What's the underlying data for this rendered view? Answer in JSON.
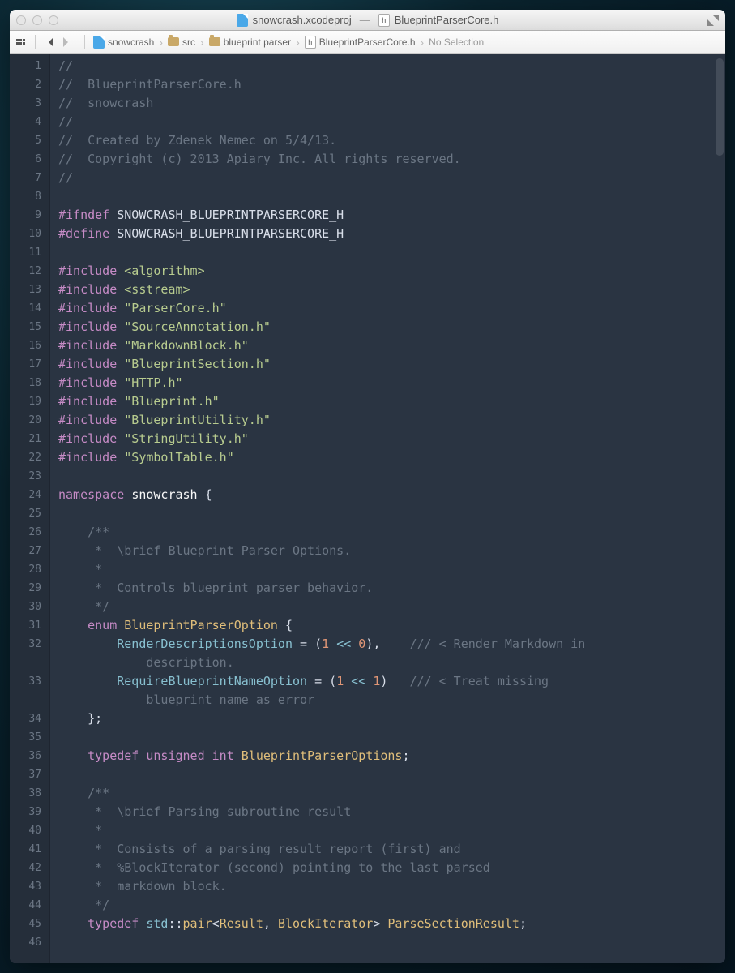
{
  "titlebar": {
    "project_name": "snowcrash.xcodeproj",
    "separator": "—",
    "file_name": "BlueprintParserCore.h",
    "h_label": "h"
  },
  "pathbar": {
    "crumbs": [
      {
        "icon": "project",
        "label": "snowcrash"
      },
      {
        "icon": "folder",
        "label": "src"
      },
      {
        "icon": "folder",
        "label": "blueprint parser"
      },
      {
        "icon": "hfile",
        "label": "BlueprintParserCore.h"
      }
    ],
    "no_selection": "No Selection"
  },
  "line_start": 1,
  "line_end": 46,
  "code_lines": [
    [
      {
        "c": "c-comment",
        "t": "//"
      }
    ],
    [
      {
        "c": "c-comment",
        "t": "//  BlueprintParserCore.h"
      }
    ],
    [
      {
        "c": "c-comment",
        "t": "//  snowcrash"
      }
    ],
    [
      {
        "c": "c-comment",
        "t": "//"
      }
    ],
    [
      {
        "c": "c-comment",
        "t": "//  Created by Zdenek Nemec on 5/4/13."
      }
    ],
    [
      {
        "c": "c-comment",
        "t": "//  Copyright (c) 2013 Apiary Inc. All rights reserved."
      }
    ],
    [
      {
        "c": "c-comment",
        "t": "//"
      }
    ],
    [],
    [
      {
        "c": "c-define",
        "t": "#ifndef "
      },
      {
        "c": "c-macro",
        "t": "SNOWCRASH_BLUEPRINTPARSERCORE_H"
      }
    ],
    [
      {
        "c": "c-define",
        "t": "#define "
      },
      {
        "c": "c-macro",
        "t": "SNOWCRASH_BLUEPRINTPARSERCORE_H"
      }
    ],
    [],
    [
      {
        "c": "c-define",
        "t": "#include "
      },
      {
        "c": "c-string",
        "t": "<algorithm>"
      }
    ],
    [
      {
        "c": "c-define",
        "t": "#include "
      },
      {
        "c": "c-string",
        "t": "<sstream>"
      }
    ],
    [
      {
        "c": "c-define",
        "t": "#include "
      },
      {
        "c": "c-string",
        "t": "\"ParserCore.h\""
      }
    ],
    [
      {
        "c": "c-define",
        "t": "#include "
      },
      {
        "c": "c-string",
        "t": "\"SourceAnnotation.h\""
      }
    ],
    [
      {
        "c": "c-define",
        "t": "#include "
      },
      {
        "c": "c-string",
        "t": "\"MarkdownBlock.h\""
      }
    ],
    [
      {
        "c": "c-define",
        "t": "#include "
      },
      {
        "c": "c-string",
        "t": "\"BlueprintSection.h\""
      }
    ],
    [
      {
        "c": "c-define",
        "t": "#include "
      },
      {
        "c": "c-string",
        "t": "\"HTTP.h\""
      }
    ],
    [
      {
        "c": "c-define",
        "t": "#include "
      },
      {
        "c": "c-string",
        "t": "\"Blueprint.h\""
      }
    ],
    [
      {
        "c": "c-define",
        "t": "#include "
      },
      {
        "c": "c-string",
        "t": "\"BlueprintUtility.h\""
      }
    ],
    [
      {
        "c": "c-define",
        "t": "#include "
      },
      {
        "c": "c-string",
        "t": "\"StringUtility.h\""
      }
    ],
    [
      {
        "c": "c-define",
        "t": "#include "
      },
      {
        "c": "c-string",
        "t": "\"SymbolTable.h\""
      }
    ],
    [],
    [
      {
        "c": "c-keyword",
        "t": "namespace "
      },
      {
        "c": "c-ident",
        "t": "snowcrash "
      },
      {
        "c": "",
        "t": "{"
      }
    ],
    [],
    [
      {
        "c": "c-comment",
        "t": "    /**"
      }
    ],
    [
      {
        "c": "c-comment",
        "t": "     *  \\brief Blueprint Parser Options."
      }
    ],
    [
      {
        "c": "c-comment",
        "t": "     *"
      }
    ],
    [
      {
        "c": "c-comment",
        "t": "     *  Controls blueprint parser behavior."
      }
    ],
    [
      {
        "c": "c-comment",
        "t": "     */"
      }
    ],
    [
      {
        "c": "",
        "t": "    "
      },
      {
        "c": "c-keyword",
        "t": "enum "
      },
      {
        "c": "c-type",
        "t": "BlueprintParserOption "
      },
      {
        "c": "",
        "t": "{"
      }
    ],
    [
      {
        "c": "",
        "t": "        "
      },
      {
        "c": "c-enum",
        "t": "RenderDescriptionsOption"
      },
      {
        "c": "",
        "t": " = ("
      },
      {
        "c": "c-number",
        "t": "1"
      },
      {
        "c": "",
        "t": " "
      },
      {
        "c": "c-op",
        "t": "<<"
      },
      {
        "c": "",
        "t": " "
      },
      {
        "c": "c-number",
        "t": "0"
      },
      {
        "c": "",
        "t": "),    "
      },
      {
        "c": "c-comment",
        "t": "/// < Render Markdown in\n            description."
      }
    ],
    [
      {
        "c": "",
        "t": "        "
      },
      {
        "c": "c-enum",
        "t": "RequireBlueprintNameOption"
      },
      {
        "c": "",
        "t": " = ("
      },
      {
        "c": "c-number",
        "t": "1"
      },
      {
        "c": "",
        "t": " "
      },
      {
        "c": "c-op",
        "t": "<<"
      },
      {
        "c": "",
        "t": " "
      },
      {
        "c": "c-number",
        "t": "1"
      },
      {
        "c": "",
        "t": ")   "
      },
      {
        "c": "c-comment",
        "t": "/// < Treat missing\n            blueprint name as error"
      }
    ],
    [
      {
        "c": "",
        "t": "    };"
      }
    ],
    [],
    [
      {
        "c": "",
        "t": "    "
      },
      {
        "c": "c-keyword",
        "t": "typedef "
      },
      {
        "c": "c-keyword",
        "t": "unsigned "
      },
      {
        "c": "c-keyword",
        "t": "int "
      },
      {
        "c": "c-type",
        "t": "BlueprintParserOptions"
      },
      {
        "c": "",
        "t": ";"
      }
    ],
    [],
    [
      {
        "c": "c-comment",
        "t": "    /**"
      }
    ],
    [
      {
        "c": "c-comment",
        "t": "     *  \\brief Parsing subroutine result"
      }
    ],
    [
      {
        "c": "c-comment",
        "t": "     *"
      }
    ],
    [
      {
        "c": "c-comment",
        "t": "     *  Consists of a parsing result report (first) and"
      }
    ],
    [
      {
        "c": "c-comment",
        "t": "     *  %BlockIterator (second) pointing to the last parsed"
      }
    ],
    [
      {
        "c": "c-comment",
        "t": "     *  markdown block."
      }
    ],
    [
      {
        "c": "c-comment",
        "t": "     */"
      }
    ],
    [
      {
        "c": "",
        "t": "    "
      },
      {
        "c": "c-keyword",
        "t": "typedef "
      },
      {
        "c": "c-ns",
        "t": "std"
      },
      {
        "c": "",
        "t": "::"
      },
      {
        "c": "c-type",
        "t": "pair"
      },
      {
        "c": "",
        "t": "<"
      },
      {
        "c": "c-type",
        "t": "Result"
      },
      {
        "c": "",
        "t": ", "
      },
      {
        "c": "c-type",
        "t": "BlockIterator"
      },
      {
        "c": "",
        "t": "> "
      },
      {
        "c": "c-type",
        "t": "ParseSectionResult"
      },
      {
        "c": "",
        "t": ";"
      }
    ],
    []
  ]
}
